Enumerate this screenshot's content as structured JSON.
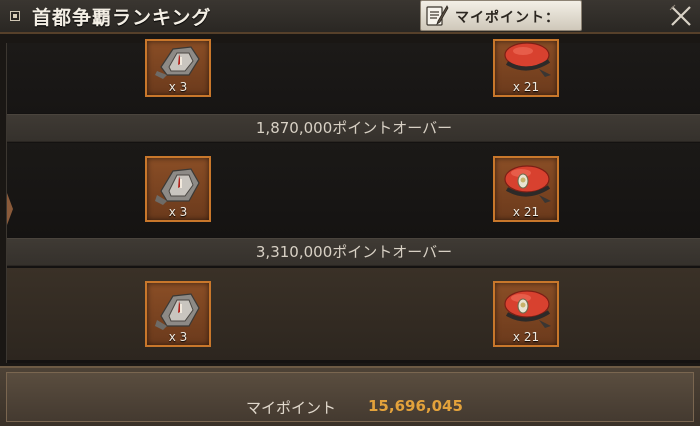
{
  "header": {
    "title": "首都争覇ランキング",
    "mypoint_button_label": "マイポイント：",
    "close_icon": "close-x-icon"
  },
  "rewards": {
    "rows": [
      {
        "items": [
          {
            "icon": "medal-item-icon",
            "count": "x 3"
          },
          {
            "icon": "red-beret-icon",
            "count": "x 21"
          }
        ]
      },
      {
        "threshold": "1,870,000ポイントオーバー",
        "items": [
          {
            "icon": "medal-item-icon",
            "count": "x 3"
          },
          {
            "icon": "red-beret-icon",
            "count": "x 21"
          }
        ]
      },
      {
        "threshold": "3,310,000ポイントオーバー",
        "items": [
          {
            "icon": "medal-item-icon",
            "count": "x 3"
          },
          {
            "icon": "red-beret-icon",
            "count": "x 21"
          }
        ]
      }
    ]
  },
  "footer": {
    "label": "マイポイント",
    "value": "15,696,045"
  },
  "colors": {
    "accent_orange": "#e3a23b",
    "slot_border": "#c8772b"
  }
}
